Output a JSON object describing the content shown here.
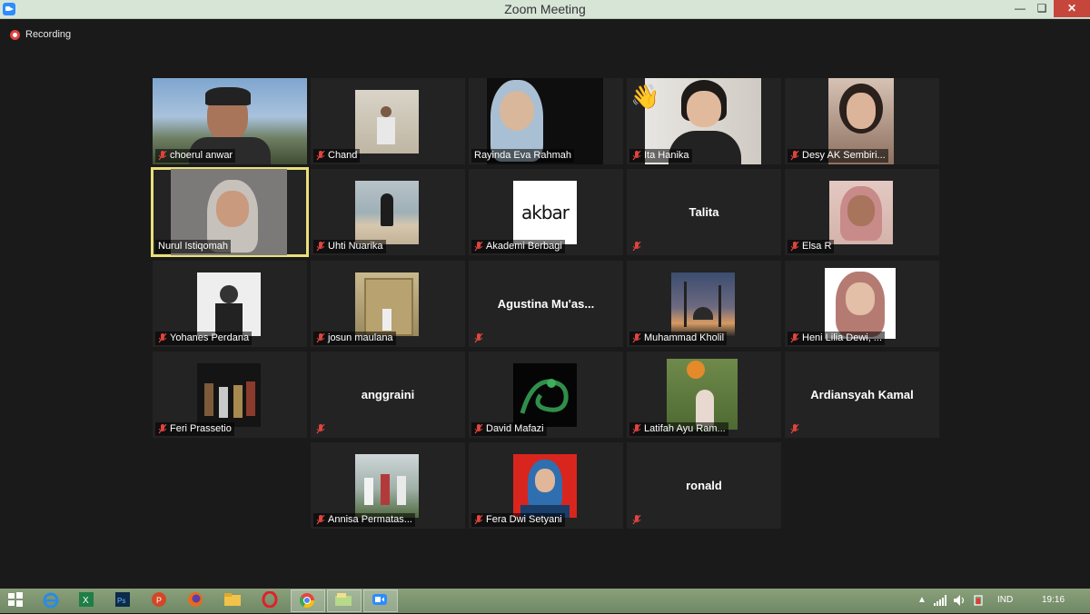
{
  "window": {
    "title": "Zoom Meeting"
  },
  "recording": {
    "label": "Recording"
  },
  "participants": [
    {
      "name": "choerul anwar"
    },
    {
      "name": "Chand"
    },
    {
      "name": "Rayinda Eva Rahmah"
    },
    {
      "name": "Ita Hanika"
    },
    {
      "name": "Desy AK Sembiri..."
    },
    {
      "name": "Nurul Istiqomah"
    },
    {
      "name": "Uhti Nuarika"
    },
    {
      "name": "Akademi Berbagi",
      "logo_text": "akbar"
    },
    {
      "name": "",
      "display": "Talita"
    },
    {
      "name": "Elsa R"
    },
    {
      "name": "Yohanes Perdana"
    },
    {
      "name": "josun maulana"
    },
    {
      "name": "",
      "display": "Agustina  Mu'as..."
    },
    {
      "name": "Muhammad Kholil"
    },
    {
      "name": "Heni Lilia Dewi, ..."
    },
    {
      "name": "Feri Prassetio"
    },
    {
      "name": "",
      "display": "anggraini"
    },
    {
      "name": "David Mafazi"
    },
    {
      "name": "Latifah Ayu Ram..."
    },
    {
      "name": "",
      "display": "Ardiansyah Kamal"
    },
    {
      "name": "Annisa Permatas..."
    },
    {
      "name": "Fera Dwi Setyani"
    },
    {
      "name": "",
      "display": "ronald"
    }
  ],
  "taskbar": {
    "language": "IND",
    "time": "19:16"
  },
  "icons": {
    "muted": "mic-muted-icon",
    "reaction": "waving-hand-icon"
  },
  "colors": {
    "active_speaker_border": "#e9e07a",
    "recording_dot": "#e0443e",
    "mute_icon": "#e0443e"
  }
}
